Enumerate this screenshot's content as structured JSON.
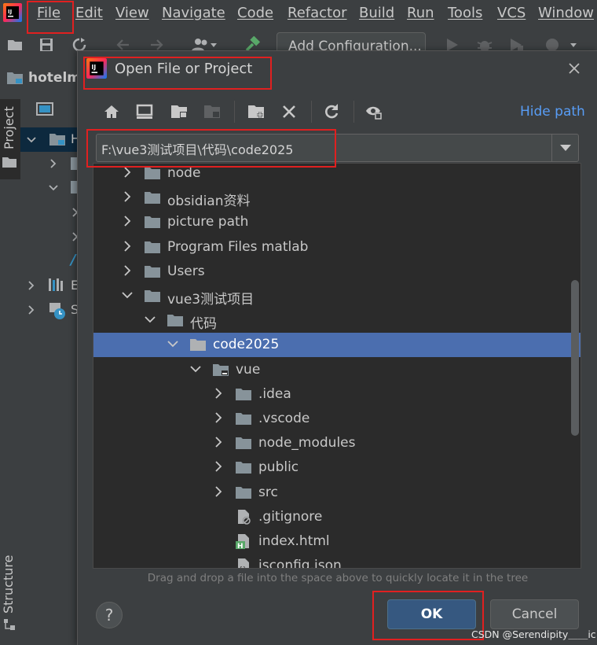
{
  "menu": [
    "File",
    "Edit",
    "View",
    "Navigate",
    "Code",
    "Refactor",
    "Build",
    "Run",
    "Tools",
    "VCS",
    "Window"
  ],
  "toolbar": {
    "add_config": "Add Configuration..."
  },
  "breadcrumb": {
    "project": "hotelm"
  },
  "sidebar": {
    "project_tab": "Project",
    "structure_tab": "Structure"
  },
  "project_tree": [
    "H",
    "E",
    "S"
  ],
  "dialog": {
    "title": "Open File or Project",
    "hide_path": "Hide path",
    "path_value": "F:\\vue3测试项目\\代码\\code2025",
    "hint": "Drag and drop a file into the space above to quickly locate it in the tree",
    "ok": "OK",
    "cancel": "Cancel",
    "help": "?"
  },
  "tree": [
    {
      "label": "node",
      "indent": 0,
      "chev": "right",
      "icon": "folder"
    },
    {
      "label": "obsidian资料",
      "indent": 0,
      "chev": "right",
      "icon": "folder"
    },
    {
      "label": "picture path",
      "indent": 0,
      "chev": "right",
      "icon": "folder"
    },
    {
      "label": "Program Files matlab",
      "indent": 0,
      "chev": "right",
      "icon": "folder"
    },
    {
      "label": "Users",
      "indent": 0,
      "chev": "right",
      "icon": "folder"
    },
    {
      "label": "vue3测试项目",
      "indent": 0,
      "chev": "down",
      "icon": "folder"
    },
    {
      "label": "代码",
      "indent": 1,
      "chev": "down",
      "icon": "folder"
    },
    {
      "label": "code2025",
      "indent": 2,
      "chev": "down",
      "icon": "folder",
      "selected": true
    },
    {
      "label": "vue",
      "indent": 3,
      "chev": "down",
      "icon": "module-folder"
    },
    {
      "label": ".idea",
      "indent": 4,
      "chev": "right",
      "icon": "folder"
    },
    {
      "label": ".vscode",
      "indent": 4,
      "chev": "right",
      "icon": "folder"
    },
    {
      "label": "node_modules",
      "indent": 4,
      "chev": "right",
      "icon": "folder"
    },
    {
      "label": "public",
      "indent": 4,
      "chev": "right",
      "icon": "folder"
    },
    {
      "label": "src",
      "indent": 4,
      "chev": "right",
      "icon": "folder"
    },
    {
      "label": ".gitignore",
      "indent": 4,
      "chev": "none",
      "icon": "ignore-file"
    },
    {
      "label": "index.html",
      "indent": 4,
      "chev": "none",
      "icon": "html-file"
    },
    {
      "label": "jsconfig.json",
      "indent": 4,
      "chev": "none",
      "icon": "json-file"
    }
  ],
  "watermark": "CSDN @Serendipity＿＿ic",
  "colors": {
    "selection": "#4b6eaf",
    "link": "#589df6",
    "highlight_box": "#e02020",
    "ok_button": "#365880"
  }
}
